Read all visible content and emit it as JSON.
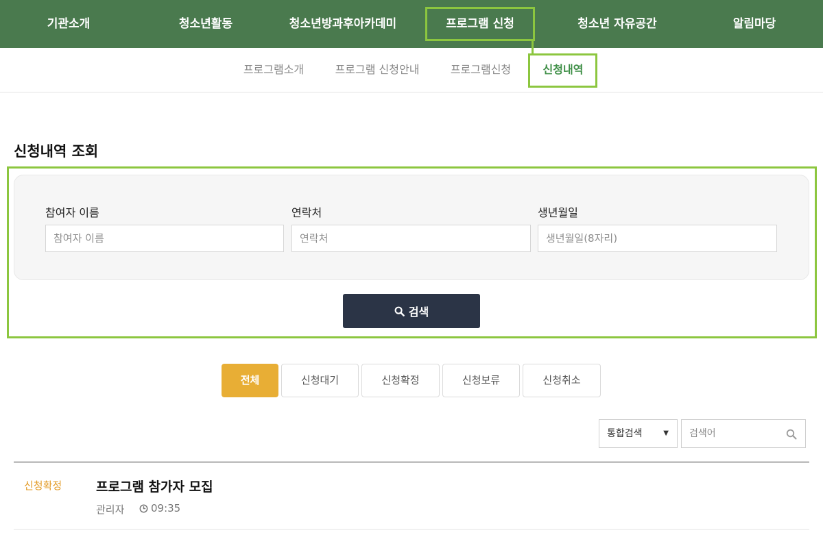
{
  "top_nav": {
    "items": [
      {
        "label": "기관소개"
      },
      {
        "label": "청소년활동"
      },
      {
        "label": "청소년방과후아카데미"
      },
      {
        "label": "프로그램 신청"
      },
      {
        "label": "청소년 자유공간"
      },
      {
        "label": "알림마당"
      }
    ],
    "active_index": 3,
    "bg_color": "#4a7a4e"
  },
  "sub_nav": {
    "items": [
      {
        "label": "프로그램소개"
      },
      {
        "label": "프로그램 신청안내"
      },
      {
        "label": "프로그램신청"
      },
      {
        "label": "신청내역"
      }
    ],
    "active_index": 3
  },
  "page_title": "신청내역 조회",
  "search_form": {
    "name": {
      "label": "참여자 이름",
      "placeholder": "참여자 이름"
    },
    "phone": {
      "label": "연락처",
      "placeholder": "연락처"
    },
    "birth": {
      "label": "생년월일",
      "placeholder": "생년월일(8자리)"
    },
    "submit_label": "검색",
    "submit_color": "#2b3446"
  },
  "status_tabs": {
    "items": [
      {
        "label": "전체"
      },
      {
        "label": "신청대기"
      },
      {
        "label": "신청확정"
      },
      {
        "label": "신청보류"
      },
      {
        "label": "신청취소"
      }
    ],
    "active_index": 0,
    "active_color": "#e8ae35"
  },
  "filter": {
    "select_value": "통합검색",
    "search_placeholder": "검색어"
  },
  "list": {
    "rows": [
      {
        "status": "신청확정",
        "title": "프로그램 참가자 모집",
        "author": "관리자",
        "time": "09:35"
      }
    ]
  },
  "highlight_color": "#8cc63f"
}
